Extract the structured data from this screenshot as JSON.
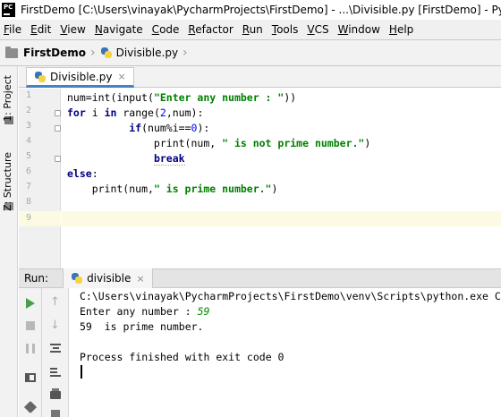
{
  "window": {
    "title": "FirstDemo [C:\\Users\\vinayak\\PycharmProjects\\FirstDemo] - ...\\Divisible.py [FirstDemo] - PyCharm",
    "logo_text": "PC"
  },
  "menu": [
    {
      "underline": "F",
      "rest": "ile"
    },
    {
      "underline": "E",
      "rest": "dit"
    },
    {
      "underline": "V",
      "rest": "iew"
    },
    {
      "underline": "N",
      "rest": "avigate"
    },
    {
      "underline": "C",
      "rest": "ode"
    },
    {
      "underline": "R",
      "rest": "efactor"
    },
    {
      "underline": "R",
      "rest": "un"
    },
    {
      "underline": "T",
      "rest": "ools"
    },
    {
      "underline": "V",
      "rest": "CS"
    },
    {
      "underline": "W",
      "rest": "indow"
    },
    {
      "underline": "H",
      "rest": "elp"
    }
  ],
  "breadcrumb": {
    "project": "FirstDemo",
    "file": "Divisible.py"
  },
  "sidebar": {
    "project_tab": "1: Project",
    "structure_tab": "Z: Structure"
  },
  "editor": {
    "tab_label": "Divisible.py",
    "close_symbol": "×",
    "line_numbers": [
      "1",
      "2",
      "3",
      "4",
      "5",
      "6",
      "7",
      "8",
      "9"
    ],
    "current_line": 9
  },
  "run": {
    "title": "Run:",
    "tab_label": "divisible",
    "close_symbol": "×",
    "console": {
      "command": "C:\\Users\\vinayak\\PycharmProjects\\FirstDemo\\venv\\Scripts\\python.exe C",
      "prompt": "Enter any number : ",
      "user_input": "59",
      "result": "59  is prime number.",
      "exit_message": "Process finished with exit code 0"
    }
  },
  "colors": {
    "keyword": "#000080",
    "string": "#008000",
    "number": "#0000ff",
    "current_line_bg": "#fcfae3",
    "run_icon": "#49a049",
    "tab_underline": "#4083c9"
  }
}
